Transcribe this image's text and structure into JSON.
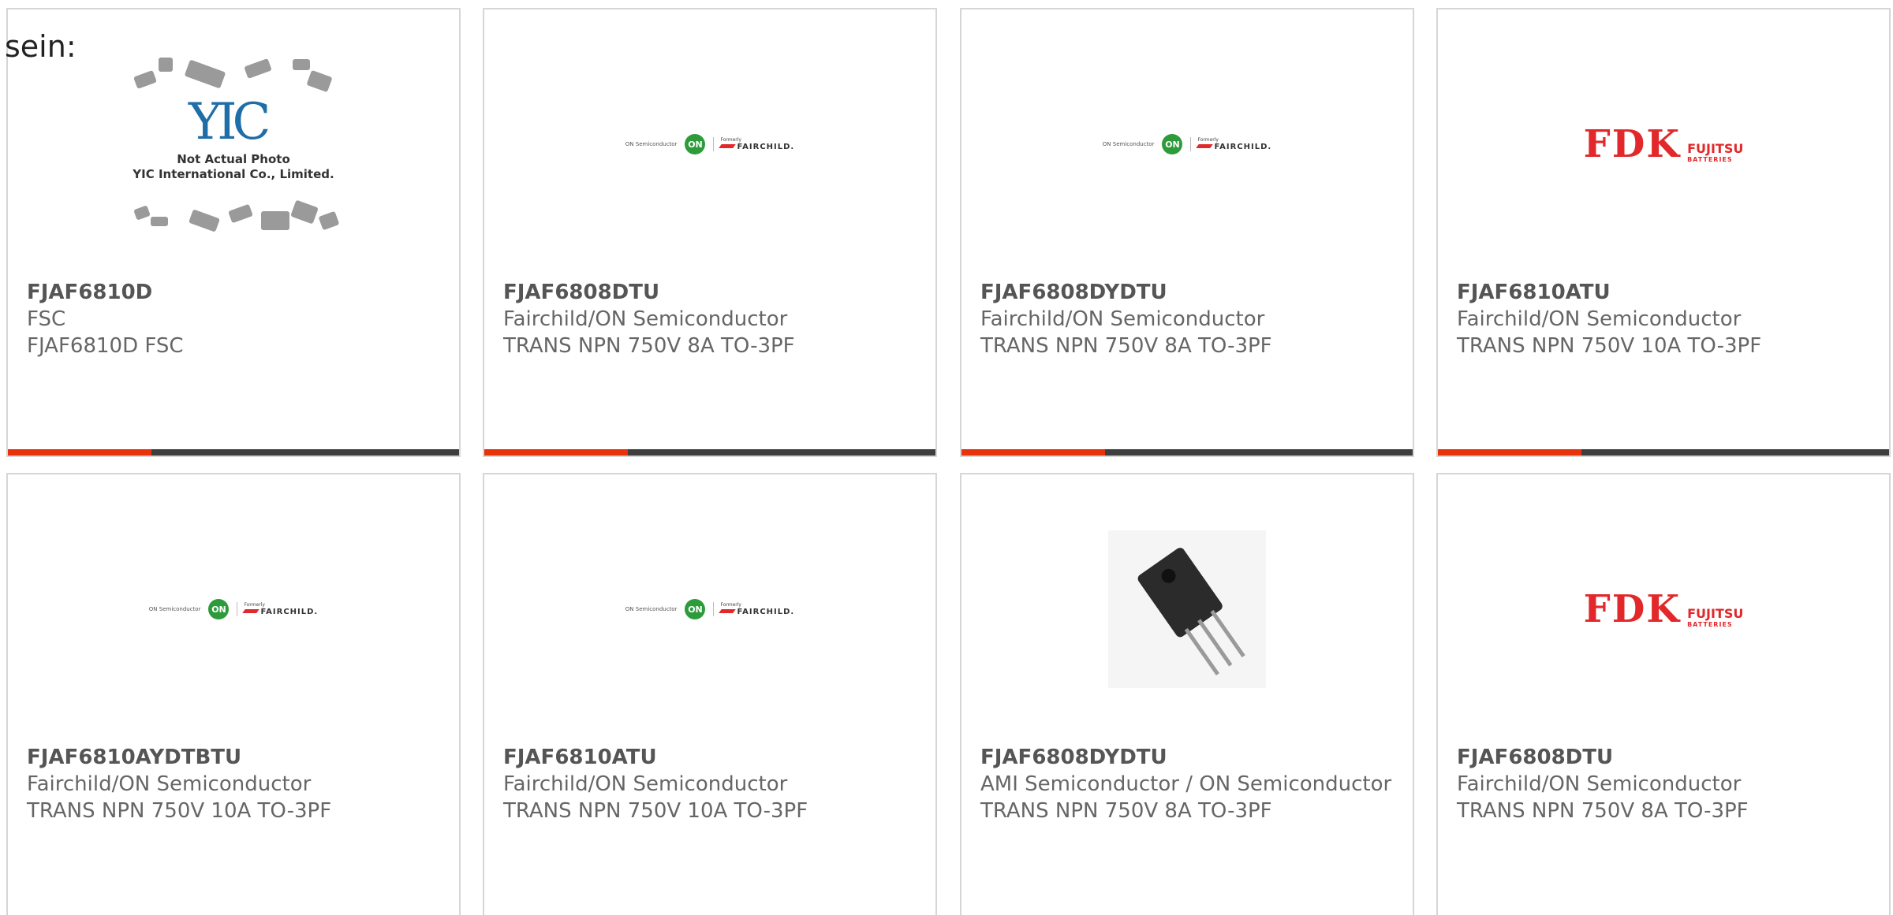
{
  "lead_text": "sein:",
  "colors": {
    "accent_bar": "#e8320b",
    "bar_dark": "#3e3e3e"
  },
  "cards": [
    {
      "part": "FJAF6810D",
      "maker": "FSC",
      "desc": "FJAF6810D FSC",
      "image": "yic-placeholder",
      "image_note": "Not Actual Photo\nYIC International Co., Limited.",
      "image_mark": "YIC"
    },
    {
      "part": "FJAF6808DTU",
      "maker": "Fairchild/ON Semiconductor",
      "desc": "TRANS NPN 750V 8A TO-3PF",
      "image": "on-fairchild-logo"
    },
    {
      "part": "FJAF6808DYDTU",
      "maker": "Fairchild/ON Semiconductor",
      "desc": "TRANS NPN 750V 8A TO-3PF",
      "image": "on-fairchild-logo"
    },
    {
      "part": "FJAF6810ATU",
      "maker": "Fairchild/ON Semiconductor",
      "desc": "TRANS NPN 750V 10A TO-3PF",
      "image": "fdk-fujitsu-logo"
    },
    {
      "part": "FJAF6810AYDTBTU",
      "maker": "Fairchild/ON Semiconductor",
      "desc": "TRANS NPN 750V 10A TO-3PF",
      "image": "on-fairchild-logo"
    },
    {
      "part": "FJAF6810ATU",
      "maker": "Fairchild/ON Semiconductor",
      "desc": "TRANS NPN 750V 10A TO-3PF",
      "image": "on-fairchild-logo"
    },
    {
      "part": "FJAF6808DYDTU",
      "maker": "AMI Semiconductor / ON Semiconductor",
      "desc": "TRANS NPN 750V 8A TO-3PF",
      "image": "transistor-photo"
    },
    {
      "part": "FJAF6808DTU",
      "maker": "Fairchild/ON Semiconductor",
      "desc": "TRANS NPN 750V 8A TO-3PF",
      "image": "fdk-fujitsu-logo"
    }
  ],
  "logos": {
    "on_text": "ON Semiconductor",
    "on_badge": "ON",
    "fc_formerly": "Formerly",
    "fc_word": "FAIRCHILD.",
    "fdk_word": "FDK",
    "fdk_brand": "FUJITSU",
    "fdk_sub": "BATTERIES"
  }
}
